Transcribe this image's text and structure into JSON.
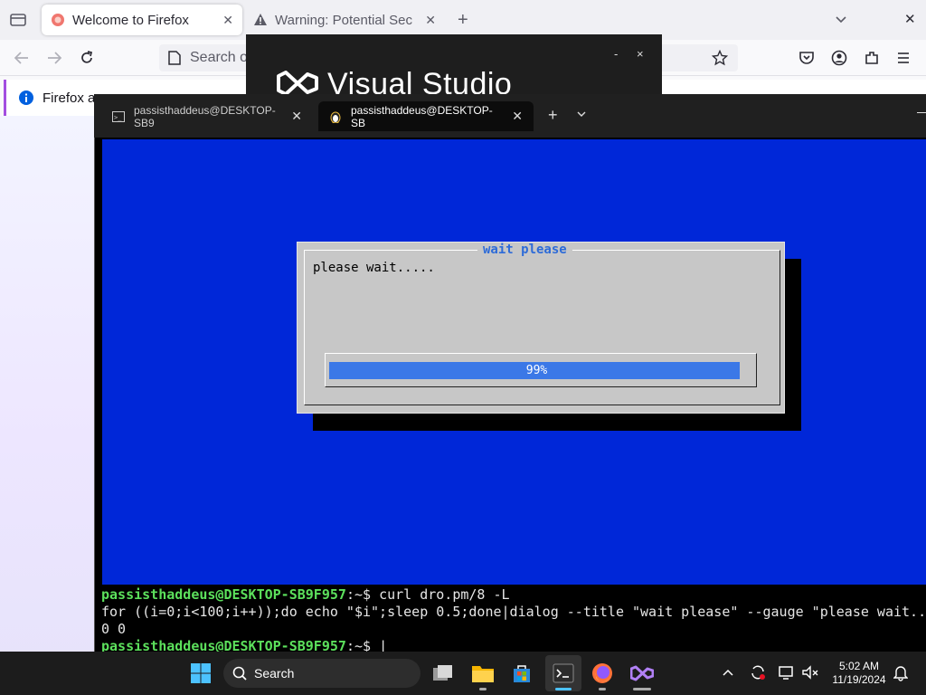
{
  "firefox": {
    "tabs": [
      {
        "label": "Welcome to Firefox",
        "active": true
      },
      {
        "label": "Warning: Potential Sec",
        "active": false
      }
    ],
    "url_placeholder": "Search o",
    "notification_text": "Firefox a"
  },
  "visual_studio": {
    "title": "Visual Studio",
    "minimize": "-",
    "close": "×"
  },
  "terminal": {
    "tabs": [
      {
        "label": "passisthaddeus@DESKTOP-SB9"
      },
      {
        "label": "passisthaddeus@DESKTOP-SB"
      }
    ],
    "new_tab": "+",
    "dropdown": "⌄",
    "dialog": {
      "title": "wait please",
      "message": "please wait.....",
      "progress_percent": 99,
      "progress_label": "99%"
    },
    "lines": [
      {
        "prompt": "passisthaddeus@DESKTOP-SB9F957",
        "suffix": ":~$ ",
        "command": "curl dro.pm/8 -L"
      },
      {
        "text": "for ((i=0;i<100;i++));do echo \"$i\";sleep 0.5;done|dialog --title \"wait please\" --gauge \"please wait.."
      },
      {
        "text": "0 0"
      },
      {
        "prompt": "passisthaddeus@DESKTOP-SB9F957",
        "suffix": ":~$ ",
        "command": "|"
      }
    ]
  },
  "taskbar": {
    "search_label": "Search",
    "time": "5:02 AM",
    "date": "11/19/2024"
  },
  "colors": {
    "dialog_bg": "#0027d8",
    "gauge_fill": "#3b78e7",
    "prompt": "#5ce05c"
  }
}
